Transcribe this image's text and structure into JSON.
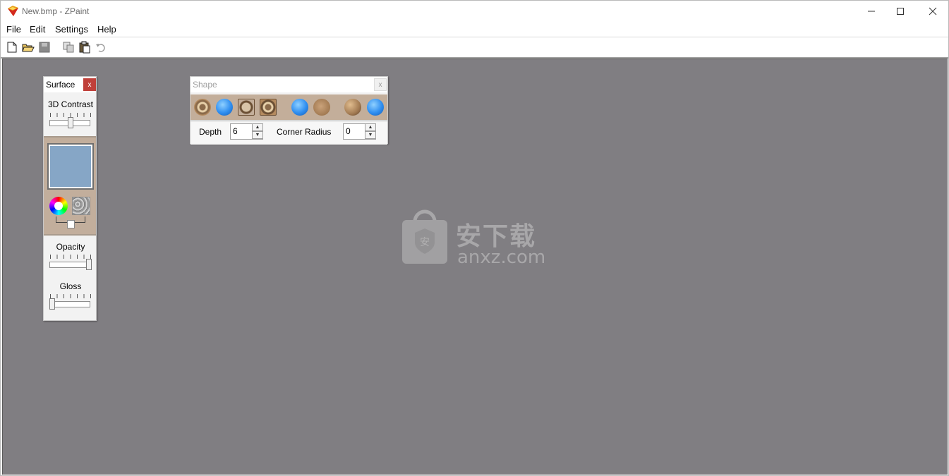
{
  "window": {
    "title": "New.bmp - ZPaint"
  },
  "menu": {
    "items": [
      "File",
      "Edit",
      "Settings",
      "Help"
    ]
  },
  "toolbar": {
    "icons": [
      "new-file-icon",
      "open-folder-icon",
      "save-icon",
      "copy-icon",
      "paste-icon",
      "undo-icon"
    ]
  },
  "surface_panel": {
    "title": "Surface",
    "close": "x",
    "contrast_label": "3D Contrast",
    "contrast_value": 0.5,
    "swatch_color": "#86a6c6",
    "opacity_label": "Opacity",
    "opacity_value": 1.0,
    "gloss_label": "Gloss",
    "gloss_value": 0.0
  },
  "shape_panel": {
    "title": "Shape",
    "close": "x",
    "depth_label": "Depth",
    "depth_value": "6",
    "corner_label": "Corner Radius",
    "corner_value": "0"
  },
  "watermark": {
    "text": "安下载",
    "sub": "anxz.com"
  },
  "colors": {
    "canvas": "#807e82",
    "panel_tan": "#c2ae9c",
    "accent_blue": "#2f8ef0"
  }
}
